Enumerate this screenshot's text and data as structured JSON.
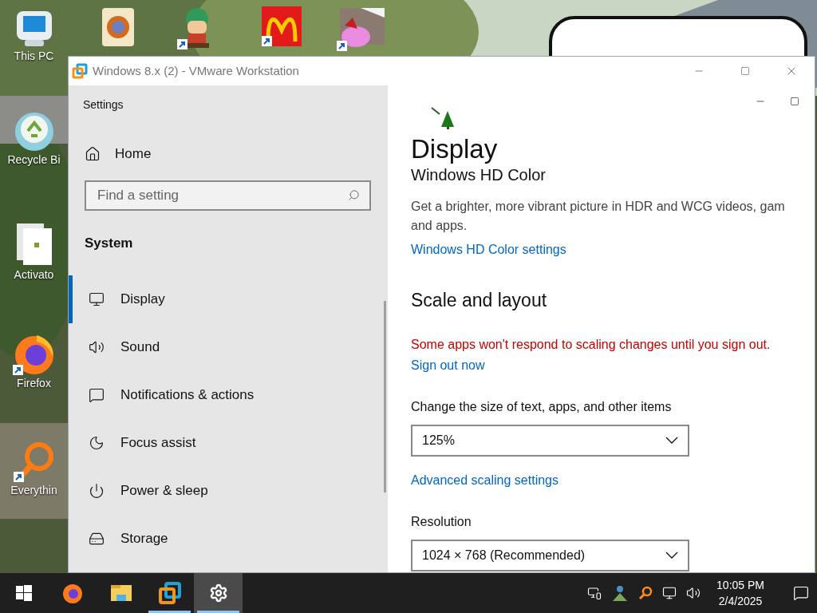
{
  "desktop": {
    "icons": [
      {
        "kind": "computer",
        "label": "This PC",
        "shortcut": false
      },
      {
        "kind": "recycle",
        "label": "Recycle Bi",
        "shortcut": false
      },
      {
        "kind": "document",
        "label": "Activato",
        "shortcut": false
      },
      {
        "kind": "firefox",
        "label": "Firefox",
        "shortcut": true
      },
      {
        "kind": "magnifier",
        "label": "Everythin",
        "shortcut": true
      }
    ],
    "top_icons": [
      {
        "kind": "speaker",
        "shortcut": false
      },
      {
        "kind": "character",
        "shortcut": true
      },
      {
        "kind": "arches",
        "shortcut": true
      },
      {
        "kind": "pig",
        "shortcut": true
      }
    ]
  },
  "window": {
    "title": "Windows 8.x (2) - VMware Workstation"
  },
  "settings": {
    "app_title": "Settings",
    "home": "Home",
    "search": {
      "placeholder": "Find a setting"
    },
    "section": "System",
    "nav": [
      {
        "kind": "display",
        "label": "Display",
        "selected": true
      },
      {
        "kind": "sound",
        "label": "Sound",
        "selected": false
      },
      {
        "kind": "notifications",
        "label": "Notifications & actions",
        "selected": false
      },
      {
        "kind": "focus",
        "label": "Focus assist",
        "selected": false
      },
      {
        "kind": "power",
        "label": "Power & sleep",
        "selected": false
      },
      {
        "kind": "storage",
        "label": "Storage",
        "selected": false
      }
    ],
    "page_title": "Display",
    "hd_heading": "Windows HD Color",
    "hd_description": [
      "Get a brighter, more vibrant picture in HDR and WCG videos, gam",
      "and apps."
    ],
    "hd_link": "Windows HD Color settings",
    "scale_heading": "Scale and layout",
    "warning": "Some apps won't respond to scaling changes until you sign out.",
    "sign_out_link": "Sign out now",
    "scale_label": "Change the size of text, apps, and other items",
    "scale_value": "125%",
    "advanced_link": "Advanced scaling settings",
    "resolution_label": "Resolution",
    "resolution_value": "1024 × 768 (Recommended)"
  },
  "taskbar": {
    "apps": [
      {
        "kind": "firefox",
        "running": false,
        "selected": false
      },
      {
        "kind": "explorer",
        "running": false,
        "selected": false
      },
      {
        "kind": "vmware",
        "running": true,
        "selected": false
      },
      {
        "kind": "settings",
        "running": true,
        "selected": true
      }
    ],
    "tray": [
      {
        "kind": "devices"
      },
      {
        "kind": "person"
      },
      {
        "kind": "magnifier"
      },
      {
        "kind": "network"
      },
      {
        "kind": "volume"
      }
    ],
    "time": "10:05 PM",
    "date": "2/4/2025"
  }
}
